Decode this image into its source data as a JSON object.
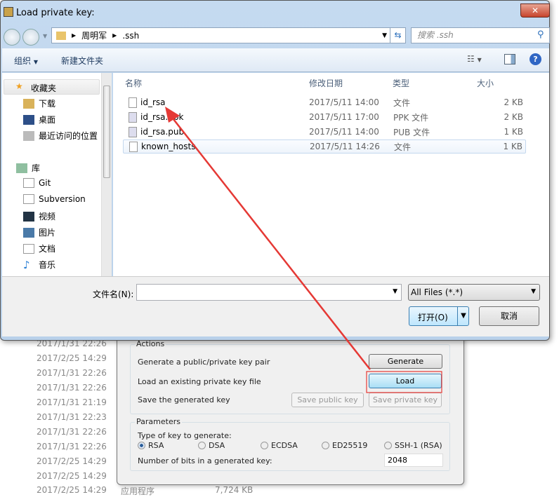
{
  "background_list": {
    "dates": [
      "2017/1/31 22:26",
      "2017/2/25 14:29",
      "2017/1/31 22:26",
      "2017/1/31 22:26",
      "2017/1/31 21:19",
      "2017/1/31 22:23",
      "2017/1/31 22:26",
      "2017/1/31 22:26",
      "2017/2/25 14:29",
      "2017/2/25 14:29",
      "2017/2/25 14:29"
    ],
    "last_type": "应用程序",
    "last_size": "7,724 KB"
  },
  "puttygen": {
    "actions_title": "Actions",
    "generate_label": "Generate a public/private key pair",
    "generate_button": "Generate",
    "load_label": "Load an existing private key file",
    "load_button": "Load",
    "save_label": "Save the generated key",
    "save_public_button": "Save public key",
    "save_private_button": "Save private key",
    "parameters_title": "Parameters",
    "key_type_label": "Type of key to generate:",
    "key_types": [
      "RSA",
      "DSA",
      "ECDSA",
      "ED25519",
      "SSH-1 (RSA)"
    ],
    "selected_key_type": "RSA",
    "bits_label": "Number of bits in a generated key:",
    "bits_value": "2048"
  },
  "dialog": {
    "title": "Load private key:",
    "breadcrumb": [
      "周明军",
      ".ssh"
    ],
    "search_placeholder": "搜索 .ssh",
    "toolbar": {
      "organize": "组织",
      "new_folder": "新建文件夹"
    },
    "nav": {
      "favorites": "收藏夹",
      "favorites_items": [
        "下载",
        "桌面",
        "最近访问的位置"
      ],
      "libraries": "库",
      "library_items": [
        "Git",
        "Subversion",
        "视频",
        "图片",
        "文档",
        "音乐"
      ]
    },
    "columns": {
      "name": "名称",
      "date": "修改日期",
      "type": "类型",
      "size": "大小"
    },
    "files": [
      {
        "name": "id_rsa",
        "date": "2017/5/11 14:00",
        "type": "文件",
        "size": "2 KB"
      },
      {
        "name": "id_rsa.ppk",
        "date": "2017/5/11 17:00",
        "type": "PPK 文件",
        "size": "2 KB"
      },
      {
        "name": "id_rsa.pub",
        "date": "2017/5/11 14:00",
        "type": "PUB 文件",
        "size": "1 KB"
      },
      {
        "name": "known_hosts",
        "date": "2017/5/11 14:26",
        "type": "文件",
        "size": "1 KB"
      }
    ],
    "filename_label": "文件名(N):",
    "filename_value": "",
    "filter": "All Files (*.*)",
    "open_button": "打开(O)",
    "cancel_button": "取消"
  },
  "annotation_color": "#e53935"
}
